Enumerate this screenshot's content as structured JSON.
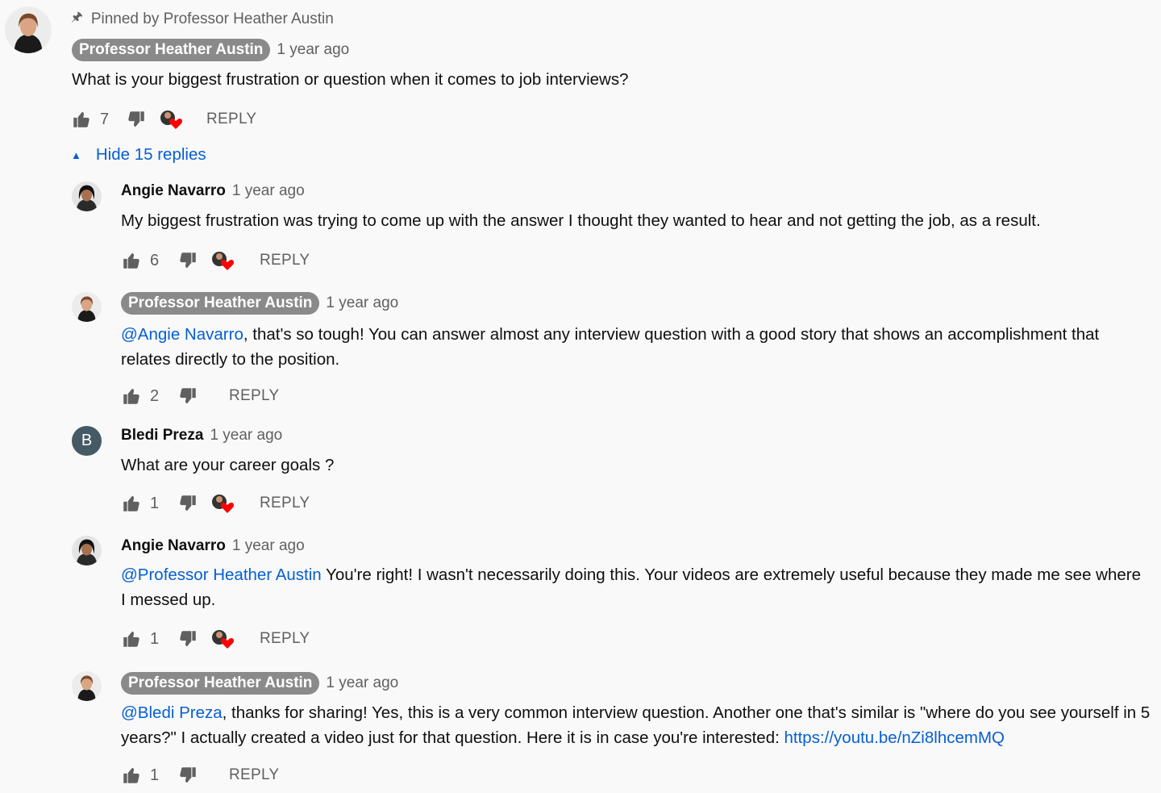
{
  "pinned": {
    "text": "Pinned by Professor Heather Austin"
  },
  "top_comment": {
    "author": "Professor Heather Austin",
    "time": "1 year ago",
    "text": "What is your biggest frustration or question when it comes to job interviews?",
    "likes": "7",
    "reply_label": "REPLY"
  },
  "replies_toggle": {
    "label": "Hide 15 replies"
  },
  "replies": [
    {
      "author": "Angie Navarro",
      "time": "1 year ago",
      "text": "My biggest frustration was trying to come up with the answer I thought they wanted to hear and not getting the job, as a result.",
      "likes": "6",
      "reply_label": "REPLY"
    },
    {
      "author": "Professor Heather Austin",
      "time": "1 year ago",
      "mention": "@Angie Navarro",
      "text": ", that's so tough! You can answer almost any interview question with a good story that shows an accomplishment that relates directly to the position.",
      "likes": "2",
      "reply_label": "REPLY"
    },
    {
      "author": "Bledi Preza",
      "time": "1 year ago",
      "avatar_letter": "B",
      "text": "What are your career goals ?",
      "likes": "1",
      "reply_label": "REPLY"
    },
    {
      "author": "Angie Navarro",
      "time": "1 year ago",
      "mention": "@Professor Heather Austin",
      "text": " You're right! I wasn't necessarily doing this. Your videos are extremely useful because they made me see where I messed up.",
      "likes": "1",
      "reply_label": "REPLY"
    },
    {
      "author": "Professor Heather Austin",
      "time": "1 year ago",
      "mention": "@Bledi Preza",
      "text": ", thanks for sharing! Yes, this is a very common interview question. Another one that's similar is \"where do you see yourself in 5 years?\" I actually created a video just for that question. Here it is in case you're interested: ",
      "link": "https://youtu.be/nZi8lhcemMQ",
      "likes": "1",
      "reply_label": "REPLY"
    }
  ],
  "colors": {
    "link": "#065fd4",
    "owner_chip": "#8a8a8a",
    "heart": "#ff0000",
    "letter_avatar": "#455a64"
  },
  "icons": [
    "pin-icon",
    "thumbs-up-icon",
    "thumbs-down-icon",
    "creator-heart-icon",
    "caret-up-icon"
  ]
}
